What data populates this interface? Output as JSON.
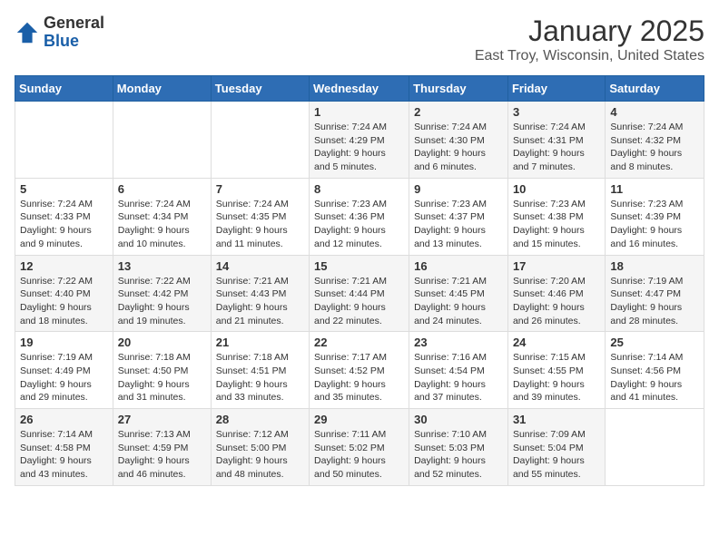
{
  "logo": {
    "general": "General",
    "blue": "Blue"
  },
  "title": "January 2025",
  "location": "East Troy, Wisconsin, United States",
  "weekdays": [
    "Sunday",
    "Monday",
    "Tuesday",
    "Wednesday",
    "Thursday",
    "Friday",
    "Saturday"
  ],
  "weeks": [
    [
      {
        "day": "",
        "sunrise": "",
        "sunset": "",
        "daylight": ""
      },
      {
        "day": "",
        "sunrise": "",
        "sunset": "",
        "daylight": ""
      },
      {
        "day": "",
        "sunrise": "",
        "sunset": "",
        "daylight": ""
      },
      {
        "day": "1",
        "sunrise": "Sunrise: 7:24 AM",
        "sunset": "Sunset: 4:29 PM",
        "daylight": "Daylight: 9 hours and 5 minutes."
      },
      {
        "day": "2",
        "sunrise": "Sunrise: 7:24 AM",
        "sunset": "Sunset: 4:30 PM",
        "daylight": "Daylight: 9 hours and 6 minutes."
      },
      {
        "day": "3",
        "sunrise": "Sunrise: 7:24 AM",
        "sunset": "Sunset: 4:31 PM",
        "daylight": "Daylight: 9 hours and 7 minutes."
      },
      {
        "day": "4",
        "sunrise": "Sunrise: 7:24 AM",
        "sunset": "Sunset: 4:32 PM",
        "daylight": "Daylight: 9 hours and 8 minutes."
      }
    ],
    [
      {
        "day": "5",
        "sunrise": "Sunrise: 7:24 AM",
        "sunset": "Sunset: 4:33 PM",
        "daylight": "Daylight: 9 hours and 9 minutes."
      },
      {
        "day": "6",
        "sunrise": "Sunrise: 7:24 AM",
        "sunset": "Sunset: 4:34 PM",
        "daylight": "Daylight: 9 hours and 10 minutes."
      },
      {
        "day": "7",
        "sunrise": "Sunrise: 7:24 AM",
        "sunset": "Sunset: 4:35 PM",
        "daylight": "Daylight: 9 hours and 11 minutes."
      },
      {
        "day": "8",
        "sunrise": "Sunrise: 7:23 AM",
        "sunset": "Sunset: 4:36 PM",
        "daylight": "Daylight: 9 hours and 12 minutes."
      },
      {
        "day": "9",
        "sunrise": "Sunrise: 7:23 AM",
        "sunset": "Sunset: 4:37 PM",
        "daylight": "Daylight: 9 hours and 13 minutes."
      },
      {
        "day": "10",
        "sunrise": "Sunrise: 7:23 AM",
        "sunset": "Sunset: 4:38 PM",
        "daylight": "Daylight: 9 hours and 15 minutes."
      },
      {
        "day": "11",
        "sunrise": "Sunrise: 7:23 AM",
        "sunset": "Sunset: 4:39 PM",
        "daylight": "Daylight: 9 hours and 16 minutes."
      }
    ],
    [
      {
        "day": "12",
        "sunrise": "Sunrise: 7:22 AM",
        "sunset": "Sunset: 4:40 PM",
        "daylight": "Daylight: 9 hours and 18 minutes."
      },
      {
        "day": "13",
        "sunrise": "Sunrise: 7:22 AM",
        "sunset": "Sunset: 4:42 PM",
        "daylight": "Daylight: 9 hours and 19 minutes."
      },
      {
        "day": "14",
        "sunrise": "Sunrise: 7:21 AM",
        "sunset": "Sunset: 4:43 PM",
        "daylight": "Daylight: 9 hours and 21 minutes."
      },
      {
        "day": "15",
        "sunrise": "Sunrise: 7:21 AM",
        "sunset": "Sunset: 4:44 PM",
        "daylight": "Daylight: 9 hours and 22 minutes."
      },
      {
        "day": "16",
        "sunrise": "Sunrise: 7:21 AM",
        "sunset": "Sunset: 4:45 PM",
        "daylight": "Daylight: 9 hours and 24 minutes."
      },
      {
        "day": "17",
        "sunrise": "Sunrise: 7:20 AM",
        "sunset": "Sunset: 4:46 PM",
        "daylight": "Daylight: 9 hours and 26 minutes."
      },
      {
        "day": "18",
        "sunrise": "Sunrise: 7:19 AM",
        "sunset": "Sunset: 4:47 PM",
        "daylight": "Daylight: 9 hours and 28 minutes."
      }
    ],
    [
      {
        "day": "19",
        "sunrise": "Sunrise: 7:19 AM",
        "sunset": "Sunset: 4:49 PM",
        "daylight": "Daylight: 9 hours and 29 minutes."
      },
      {
        "day": "20",
        "sunrise": "Sunrise: 7:18 AM",
        "sunset": "Sunset: 4:50 PM",
        "daylight": "Daylight: 9 hours and 31 minutes."
      },
      {
        "day": "21",
        "sunrise": "Sunrise: 7:18 AM",
        "sunset": "Sunset: 4:51 PM",
        "daylight": "Daylight: 9 hours and 33 minutes."
      },
      {
        "day": "22",
        "sunrise": "Sunrise: 7:17 AM",
        "sunset": "Sunset: 4:52 PM",
        "daylight": "Daylight: 9 hours and 35 minutes."
      },
      {
        "day": "23",
        "sunrise": "Sunrise: 7:16 AM",
        "sunset": "Sunset: 4:54 PM",
        "daylight": "Daylight: 9 hours and 37 minutes."
      },
      {
        "day": "24",
        "sunrise": "Sunrise: 7:15 AM",
        "sunset": "Sunset: 4:55 PM",
        "daylight": "Daylight: 9 hours and 39 minutes."
      },
      {
        "day": "25",
        "sunrise": "Sunrise: 7:14 AM",
        "sunset": "Sunset: 4:56 PM",
        "daylight": "Daylight: 9 hours and 41 minutes."
      }
    ],
    [
      {
        "day": "26",
        "sunrise": "Sunrise: 7:14 AM",
        "sunset": "Sunset: 4:58 PM",
        "daylight": "Daylight: 9 hours and 43 minutes."
      },
      {
        "day": "27",
        "sunrise": "Sunrise: 7:13 AM",
        "sunset": "Sunset: 4:59 PM",
        "daylight": "Daylight: 9 hours and 46 minutes."
      },
      {
        "day": "28",
        "sunrise": "Sunrise: 7:12 AM",
        "sunset": "Sunset: 5:00 PM",
        "daylight": "Daylight: 9 hours and 48 minutes."
      },
      {
        "day": "29",
        "sunrise": "Sunrise: 7:11 AM",
        "sunset": "Sunset: 5:02 PM",
        "daylight": "Daylight: 9 hours and 50 minutes."
      },
      {
        "day": "30",
        "sunrise": "Sunrise: 7:10 AM",
        "sunset": "Sunset: 5:03 PM",
        "daylight": "Daylight: 9 hours and 52 minutes."
      },
      {
        "day": "31",
        "sunrise": "Sunrise: 7:09 AM",
        "sunset": "Sunset: 5:04 PM",
        "daylight": "Daylight: 9 hours and 55 minutes."
      },
      {
        "day": "",
        "sunrise": "",
        "sunset": "",
        "daylight": ""
      }
    ]
  ]
}
